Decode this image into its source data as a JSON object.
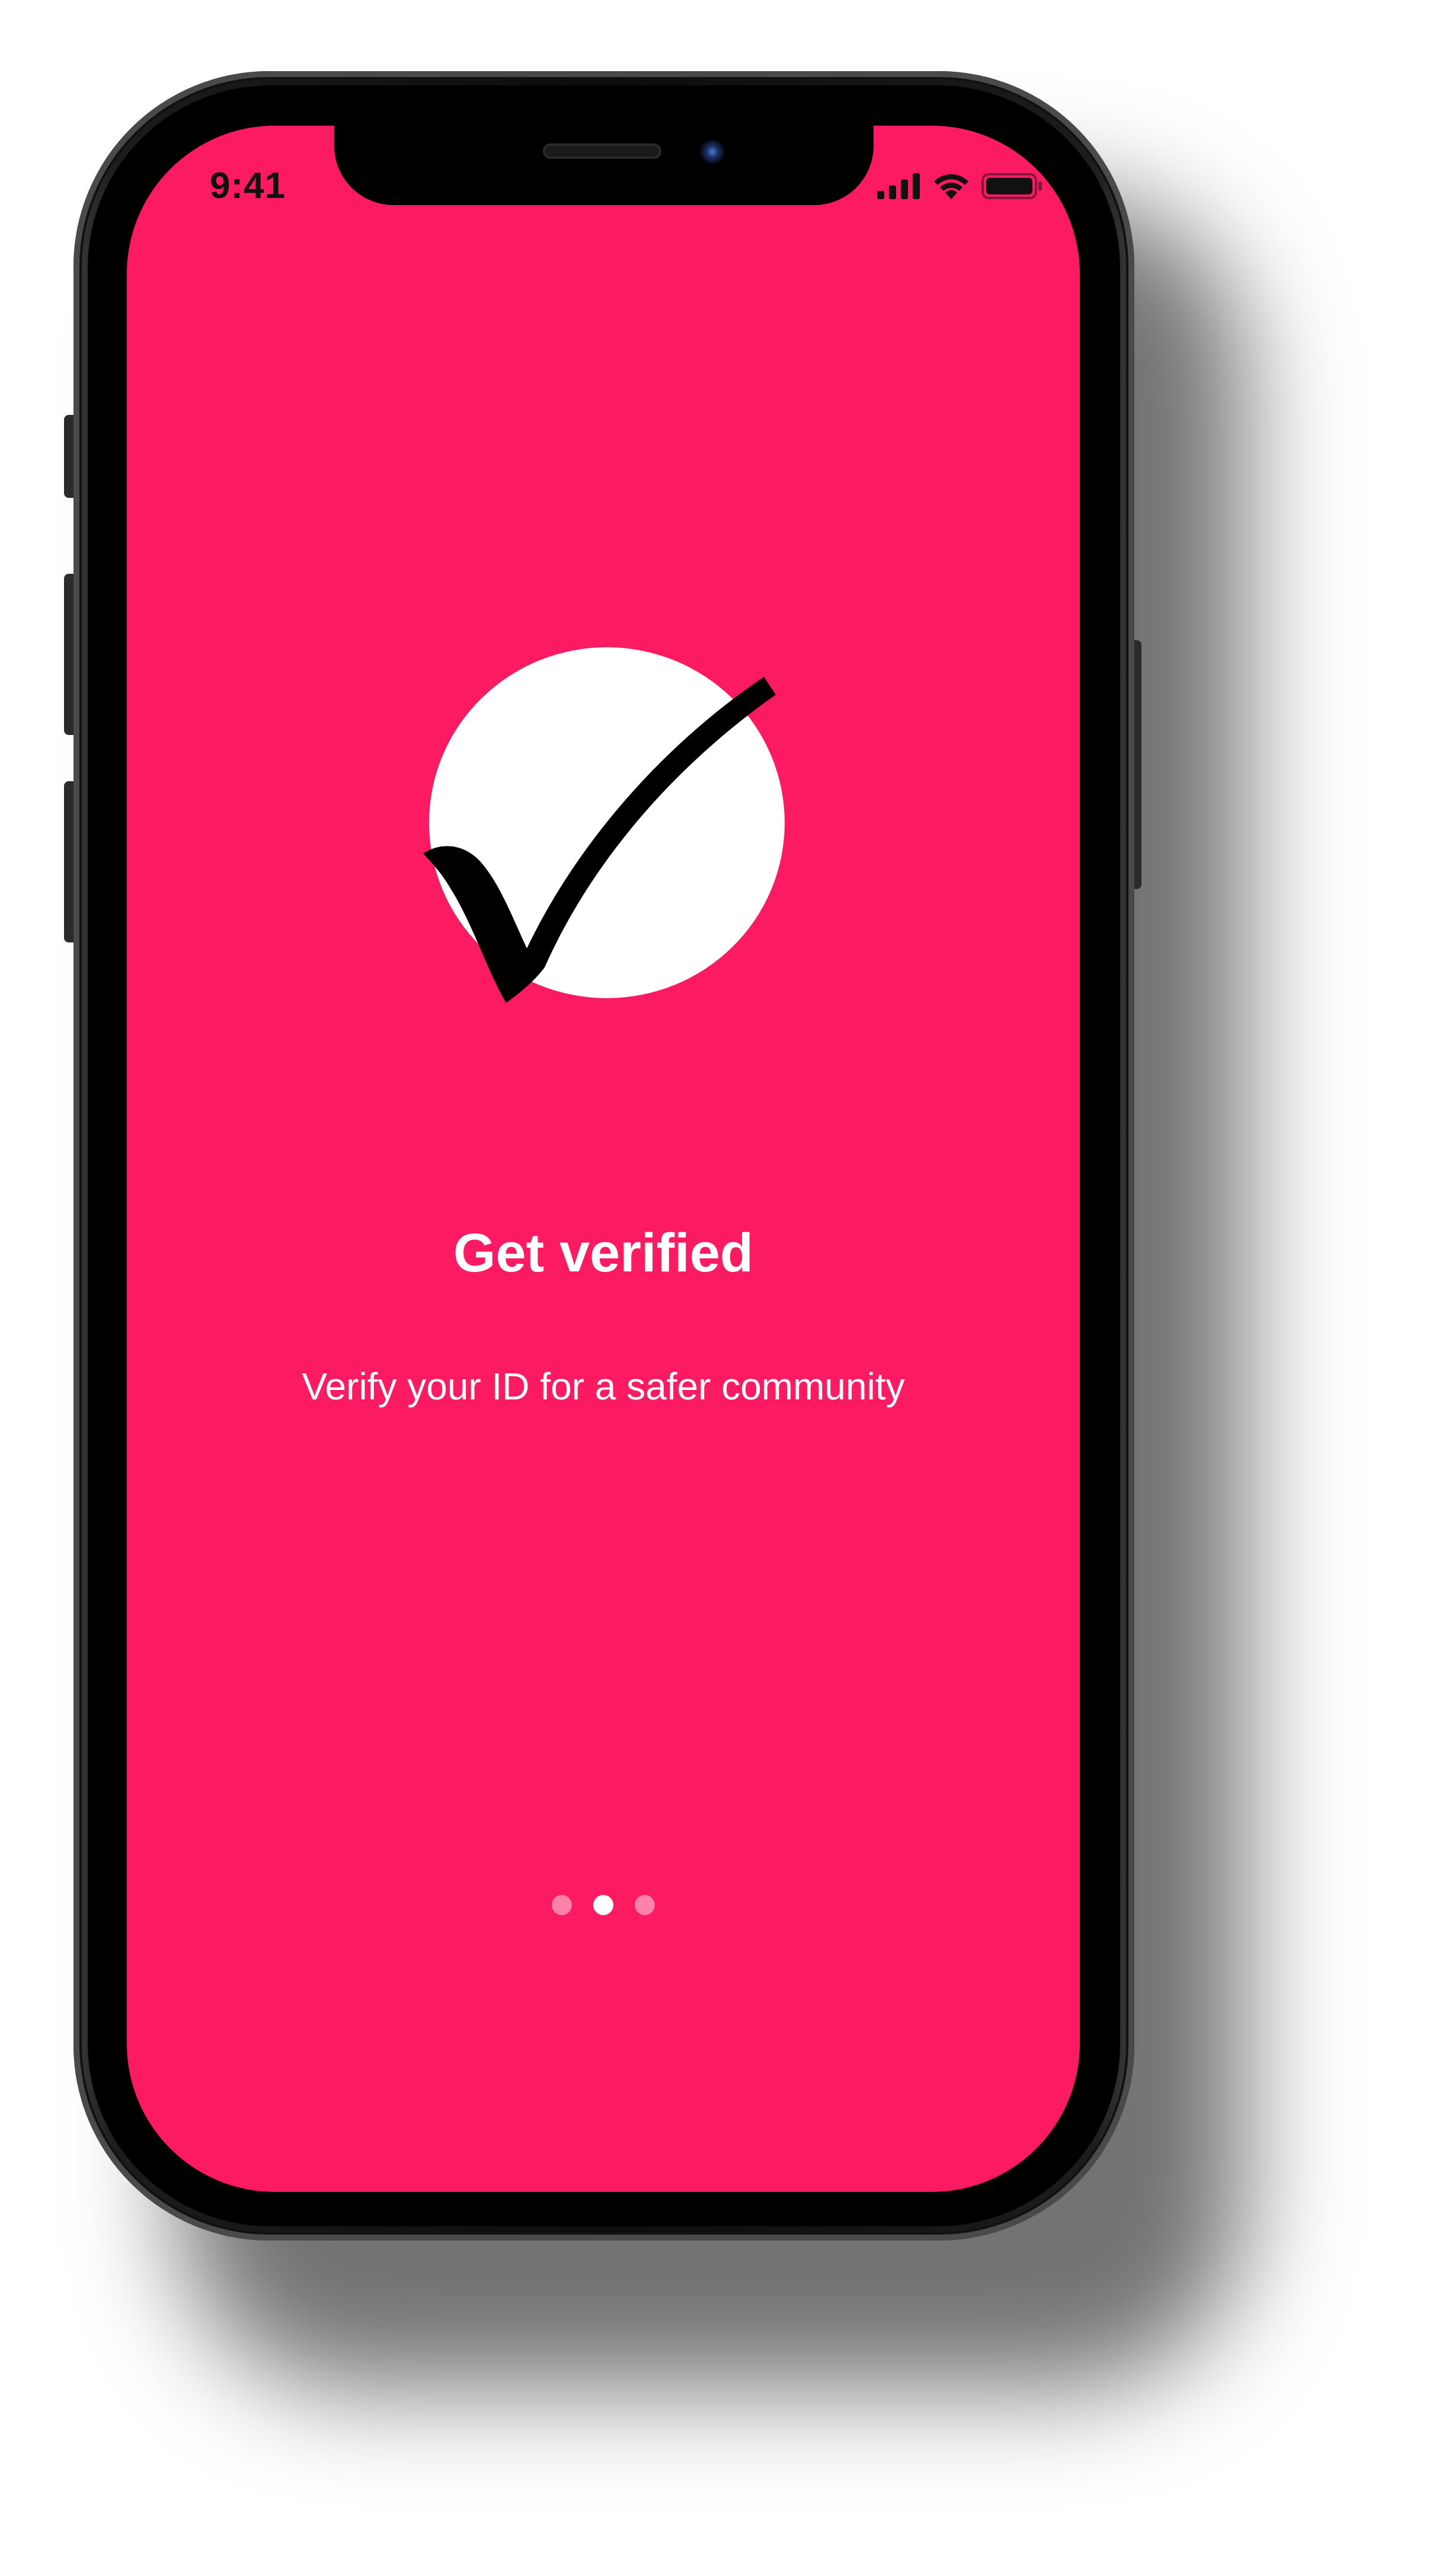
{
  "status_bar": {
    "time": "9:41",
    "icons": [
      "cellular-signal-icon",
      "wifi-icon",
      "battery-icon"
    ]
  },
  "onboarding": {
    "illustration": "checkmark-in-circle-icon",
    "title": "Get verified",
    "subtitle": "Verify your ID for a safer community",
    "pagination": {
      "total_pages": 3,
      "current_page": 2
    }
  },
  "colors": {
    "background": "#fc1b63",
    "text": "#ffffff",
    "checkmark": "#000000",
    "circle": "#ffffff"
  }
}
